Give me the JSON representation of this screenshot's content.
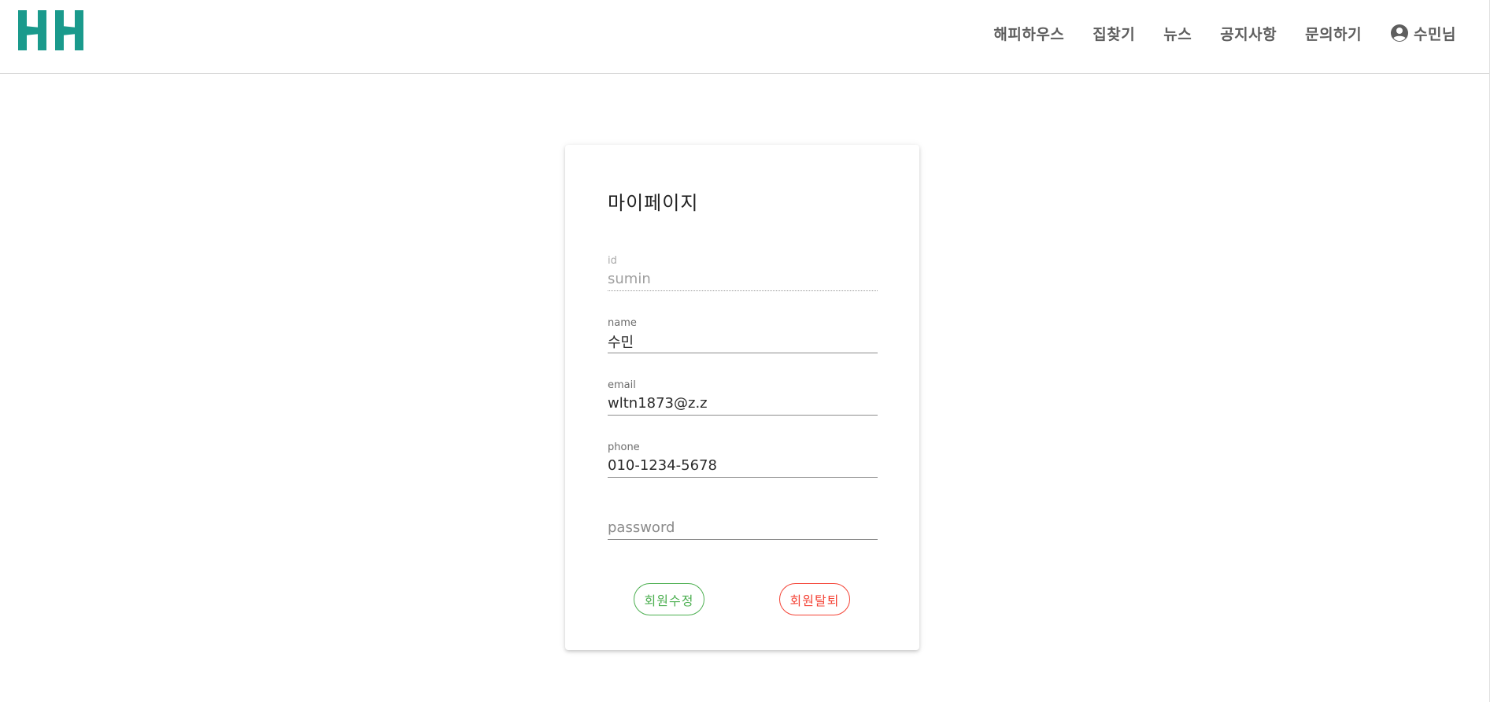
{
  "header": {
    "logo_text": "HH",
    "nav": {
      "items": [
        {
          "label": "해피하우스"
        },
        {
          "label": "집찾기"
        },
        {
          "label": "뉴스"
        },
        {
          "label": "공지사항"
        },
        {
          "label": "문의하기"
        }
      ],
      "user_label": "수민님",
      "user_icon": "account-circle-icon"
    }
  },
  "mypage": {
    "title": "마이페이지",
    "fields": {
      "id": {
        "label": "id",
        "value": "sumin",
        "disabled": true
      },
      "name": {
        "label": "name",
        "value": "수민"
      },
      "email": {
        "label": "email",
        "value": "wltn1873@z.z"
      },
      "phone": {
        "label": "phone",
        "value": "010-1234-5678"
      },
      "password": {
        "placeholder": "password",
        "value": ""
      }
    },
    "buttons": {
      "update_label": "회원수정",
      "withdraw_label": "회원탈퇴"
    }
  },
  "colors": {
    "brand": "#1a9a8c",
    "update": "#4caf50",
    "withdraw": "#f44336"
  }
}
